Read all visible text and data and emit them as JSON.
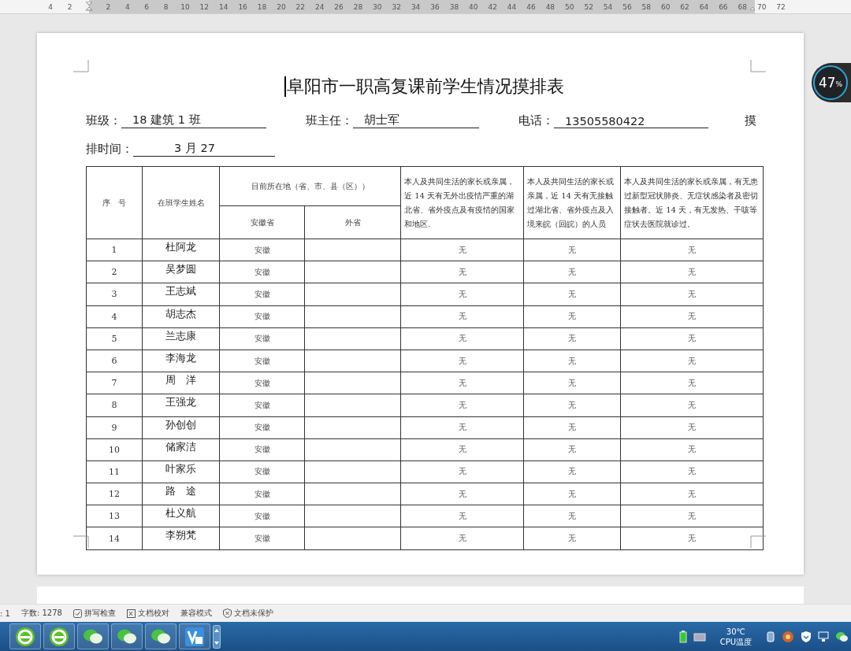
{
  "ruler": {
    "left_ticks": [
      "4",
      "2"
    ],
    "ticks": [
      "2",
      "4",
      "6",
      "8",
      "10",
      "12",
      "14",
      "16",
      "18",
      "20",
      "22",
      "24",
      "26",
      "28",
      "30",
      "32",
      "34",
      "36",
      "38",
      "40",
      "42",
      "44",
      "46",
      "48",
      "50",
      "52",
      "54",
      "56",
      "58",
      "60",
      "62",
      "64",
      "66",
      "68"
    ],
    "right_ticks": [
      "70",
      "72"
    ]
  },
  "progress_widget": {
    "value": "47",
    "unit": "%"
  },
  "document": {
    "title": "阜阳市一职高复课前学生情况摸排表",
    "fields": [
      {
        "label": "班级：",
        "value": "18 建筑 1 班"
      },
      {
        "label": "班主任：",
        "value": "胡士军"
      },
      {
        "label": "电话：",
        "value": "13505580422"
      }
    ],
    "line_end": "摸",
    "date_field": {
      "label": "排时间：",
      "value": "3 月 27"
    },
    "table": {
      "headers": {
        "number": "序　号",
        "name": "在班学生姓名",
        "location": "目前所在地（省、市、县（区））",
        "province": "安徽省",
        "other_province": "外省",
        "contact_abroad": "本人及共同生活的家长或亲属，近 14 天有无外出疫情严重的湖北省、省外疫点及有疫情的国家和地区.",
        "contact_hubei": "本人及共同生活的家长或亲属，近 14 天有无接触过湖北省、省外疫点及入境来皖（回皖）的人员",
        "symptoms": "本人及共同生活的家长或亲属，有无患过新型冠状肺炎、无症状感染者及密切接触者。近 14 天，有无发热、干咳等症状去医院就诊过。"
      },
      "rows": [
        {
          "number": "1",
          "name": "杜阿龙",
          "province": "安徽",
          "contact_abroad": "无",
          "contact_hubei": "无",
          "symptoms": "无"
        },
        {
          "number": "2",
          "name": "吴梦圆",
          "province": "安徽",
          "contact_abroad": "无",
          "contact_hubei": "无",
          "symptoms": "无"
        },
        {
          "number": "3",
          "name": "王志斌",
          "province": "安徽",
          "contact_abroad": "无",
          "contact_hubei": "无",
          "symptoms": "无"
        },
        {
          "number": "4",
          "name": "胡志杰",
          "province": "安徽",
          "contact_abroad": "无",
          "contact_hubei": "无",
          "symptoms": "无"
        },
        {
          "number": "5",
          "name": "兰志康",
          "province": "安徽",
          "contact_abroad": "无",
          "contact_hubei": "无",
          "symptoms": "无"
        },
        {
          "number": "6",
          "name": "李海龙",
          "province": "安徽",
          "contact_abroad": "无",
          "contact_hubei": "无",
          "symptoms": "无"
        },
        {
          "number": "7",
          "name": "周　洋",
          "province": "安徽",
          "contact_abroad": "无",
          "contact_hubei": "无",
          "symptoms": "无"
        },
        {
          "number": "8",
          "name": "王强龙",
          "province": "安徽",
          "contact_abroad": "无",
          "contact_hubei": "无",
          "symptoms": "无"
        },
        {
          "number": "9",
          "name": "孙创创",
          "province": "安徽",
          "contact_abroad": "无",
          "contact_hubei": "无",
          "symptoms": "无"
        },
        {
          "number": "10",
          "name": "储家洁",
          "province": "安徽",
          "contact_abroad": "无",
          "contact_hubei": "无",
          "symptoms": "无"
        },
        {
          "number": "11",
          "name": "叶家乐",
          "province": "安徽",
          "contact_abroad": "无",
          "contact_hubei": "无",
          "symptoms": "无"
        },
        {
          "number": "12",
          "name": "路　途",
          "province": "安徽",
          "contact_abroad": "无",
          "contact_hubei": "无",
          "symptoms": "无"
        },
        {
          "number": "13",
          "name": "杜义航",
          "province": "安徽",
          "contact_abroad": "无",
          "contact_hubei": "无",
          "symptoms": "无"
        },
        {
          "number": "14",
          "name": "李朔梵",
          "province": "安徽",
          "contact_abroad": "无",
          "contact_hubei": "无",
          "symptoms": "无"
        }
      ]
    }
  },
  "status_bar": {
    "page": ": 1",
    "word_count": "字数: 1278",
    "items": [
      {
        "kind": "check",
        "label": "拼写检查"
      },
      {
        "kind": "doc",
        "label": "文档校对"
      },
      {
        "kind": "plain",
        "label": "兼容模式"
      },
      {
        "kind": "shield",
        "label": "文档未保护"
      }
    ]
  },
  "taskbar": {
    "apps": [
      {
        "kind": "browser"
      },
      {
        "kind": "browser"
      },
      {
        "kind": "chat"
      },
      {
        "kind": "chat"
      },
      {
        "kind": "chat"
      },
      {
        "kind": "editor"
      }
    ],
    "temperature": "30℃",
    "temperature_label": "CPU温度"
  }
}
